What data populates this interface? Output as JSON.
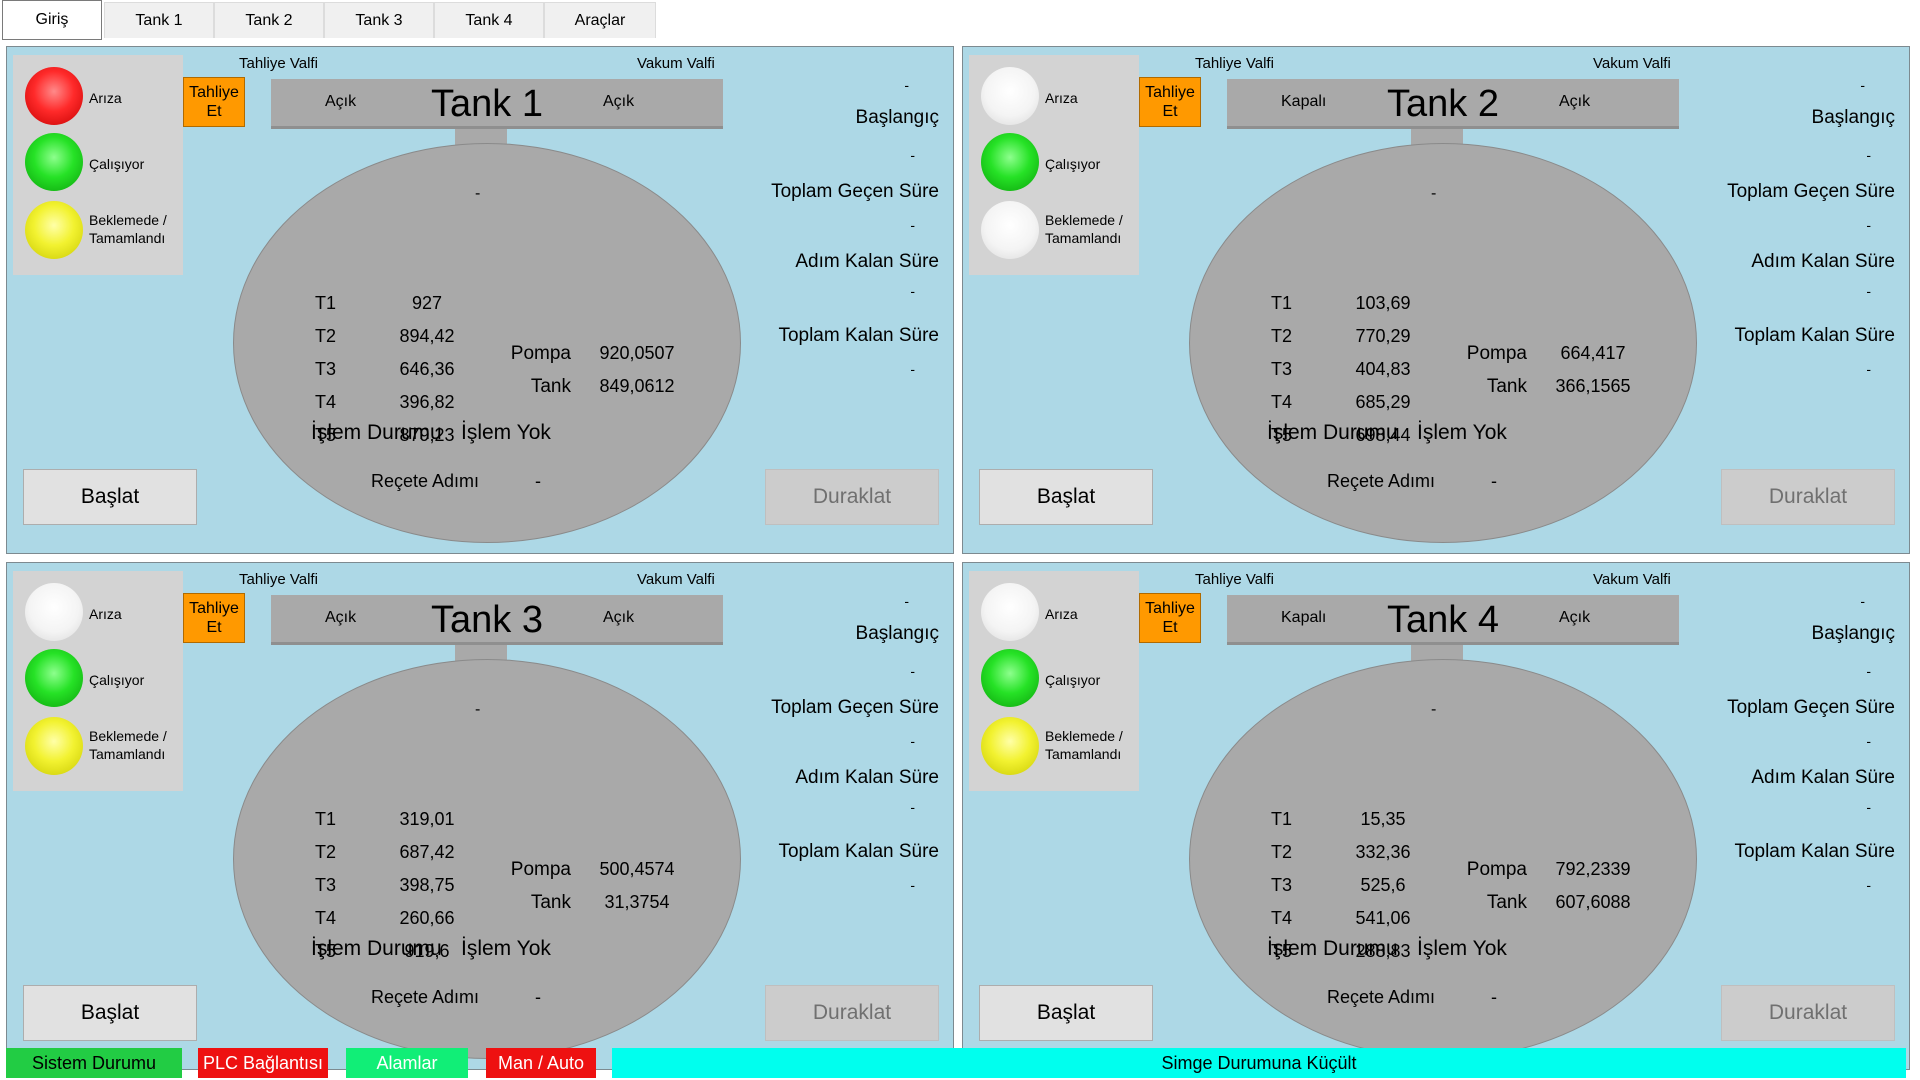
{
  "tabs": [
    {
      "label": "Giriş",
      "active": true
    },
    {
      "label": "Tank 1",
      "active": false
    },
    {
      "label": "Tank 2",
      "active": false
    },
    {
      "label": "Tank 3",
      "active": false
    },
    {
      "label": "Tank 4",
      "active": false
    },
    {
      "label": "Araçlar",
      "active": false
    }
  ],
  "labels": {
    "fault": "Arıza",
    "running": "Çalışıyor",
    "waiting": "Beklemede / Tamamlandı",
    "drain_valve": "Tahliye Valfi",
    "vacuum_valve": "Vakum Valfi",
    "drain_button": "Tahliye Et",
    "pump": "Pompa",
    "tank": "Tank",
    "process_status": "İşlem Durumu",
    "recipe_step": "Reçete Adımı",
    "start_time": "Başlangıç",
    "elapsed": "Toplam Geçen Süre",
    "step_remaining": "Adım Kalan Süre",
    "total_remaining": "Toplam Kalan Süre",
    "start_button": "Başlat",
    "pause_button": "Duraklat",
    "dash": "-"
  },
  "colors": {
    "panel_bg": "#add8e6",
    "tank_gray": "#a9a9a9",
    "lamp_red": "#ff2a2a",
    "lamp_green": "#26e226",
    "lamp_yellow": "#f2f230",
    "lamp_off": "#f4f4f4",
    "drain_button": "#ff9900"
  },
  "tanks": [
    {
      "title": "Tank 1",
      "lamps": {
        "fault": "red",
        "running": "green",
        "waiting": "yellow"
      },
      "drain_valve": {
        "state": "Açık",
        "color": "green"
      },
      "vacuum_valve": {
        "state": "Açık",
        "color": "green"
      },
      "t_values": [
        "927",
        "894,42",
        "646,36",
        "396,82",
        "879,23"
      ],
      "pump": "920,0507",
      "tank_value": "849,0612",
      "process_status": "İşlem Yok",
      "recipe_step": "-"
    },
    {
      "title": "Tank 2",
      "lamps": {
        "fault": "white",
        "running": "green",
        "waiting": "white"
      },
      "drain_valve": {
        "state": "Kapalı",
        "color": "red"
      },
      "vacuum_valve": {
        "state": "Açık",
        "color": "green"
      },
      "t_values": [
        "103,69",
        "770,29",
        "404,83",
        "685,29",
        "698,44"
      ],
      "pump": "664,417",
      "tank_value": "366,1565",
      "process_status": "İşlem Yok",
      "recipe_step": "-"
    },
    {
      "title": "Tank 3",
      "lamps": {
        "fault": "white",
        "running": "green",
        "waiting": "yellow"
      },
      "drain_valve": {
        "state": "Açık",
        "color": "green"
      },
      "vacuum_valve": {
        "state": "Açık",
        "color": "green"
      },
      "t_values": [
        "319,01",
        "687,42",
        "398,75",
        "260,66",
        "919,6"
      ],
      "pump": "500,4574",
      "tank_value": "31,3754",
      "process_status": "İşlem Yok",
      "recipe_step": "-"
    },
    {
      "title": "Tank 4",
      "lamps": {
        "fault": "white",
        "running": "green",
        "waiting": "yellow"
      },
      "drain_valve": {
        "state": "Kapalı",
        "color": "red"
      },
      "vacuum_valve": {
        "state": "Açık",
        "color": "green"
      },
      "t_values": [
        "15,35",
        "332,36",
        "525,6",
        "541,06",
        "288,83"
      ],
      "pump": "792,2339",
      "tank_value": "607,6088",
      "process_status": "İşlem Yok",
      "recipe_step": "-"
    }
  ],
  "bottom_bar": [
    {
      "label": "Sistem Durumu",
      "bg": "#22cc44",
      "fg": "#000000"
    },
    {
      "label": "PLC Bağlantısı",
      "bg": "#ee1111",
      "fg": "#ffffff"
    },
    {
      "label": "Alamlar",
      "bg": "#11ee77",
      "fg": "#ffffff"
    },
    {
      "label": "Man / Auto",
      "bg": "#ee1111",
      "fg": "#ffffff"
    },
    {
      "label": "Simge Durumuna Küçült",
      "bg": "#00ffee",
      "fg": "#000000"
    }
  ]
}
